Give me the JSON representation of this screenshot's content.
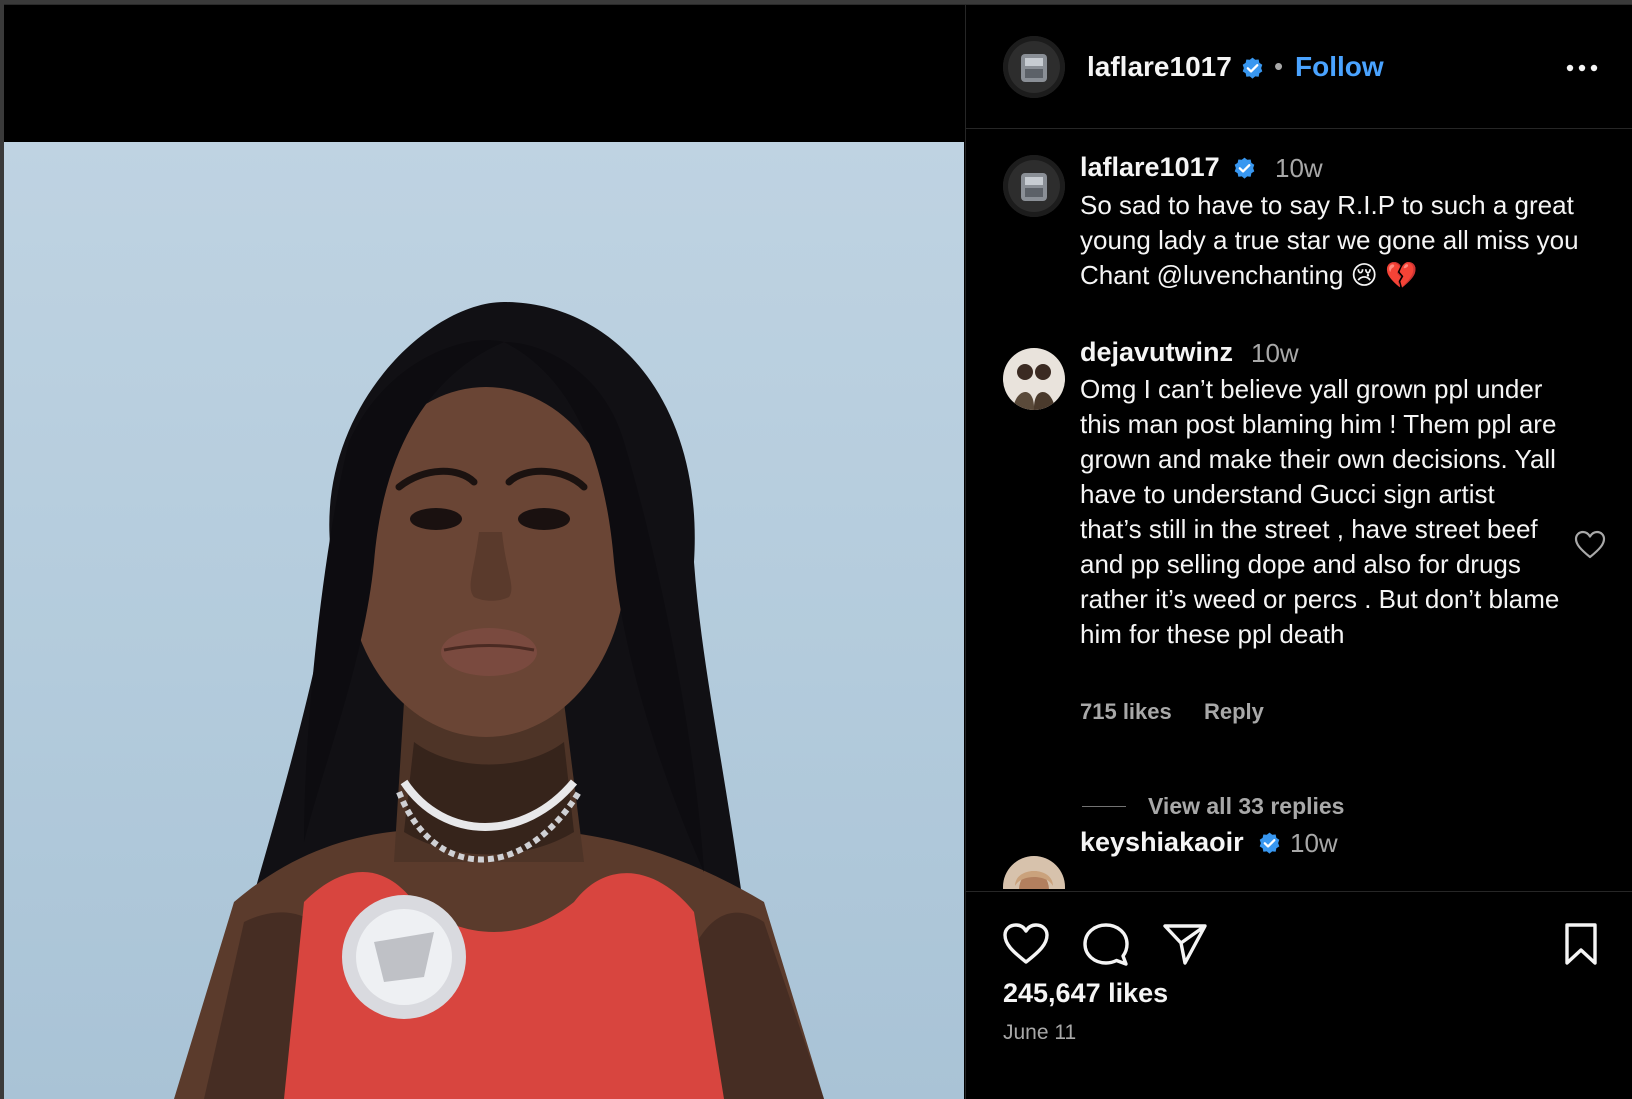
{
  "post": {
    "author": "laflare1017",
    "follow_label": "Follow",
    "separator": "•",
    "caption": {
      "author": "laflare1017",
      "time": "10w",
      "text": "So sad to have to say R.I.P to such a great young lady a true star we gone all miss you Chant @luvenchanting 😢 💔"
    },
    "likes": "245,647 likes",
    "date": "June 11"
  },
  "comments": [
    {
      "author": "dejavutwinz",
      "time": "10w",
      "text": "Omg I can’t believe yall grown ppl under this man post blaming him ! Them ppl are grown and make their own decisions. Yall have to understand Gucci sign artist that’s still in the street , have street beef and pp selling dope and also for drugs rather it’s weed or percs . But don’t blame him for these ppl death",
      "likes": "715 likes",
      "reply_label": "Reply",
      "view_replies": "View all 33 replies"
    },
    {
      "author": "keyshiakaoir",
      "time": "10w",
      "verified": true
    }
  ],
  "icons": {
    "more": "more-options-icon",
    "verified": "verified-badge-icon",
    "like": "heart-icon",
    "comment": "comment-bubble-icon",
    "share": "paper-plane-icon",
    "save": "bookmark-icon"
  },
  "colors": {
    "background": "#000000",
    "text": "#f5f5f5",
    "secondary_text": "#a8a8a8",
    "link": "#4aa3ff",
    "verified": "#3897f0",
    "photo_backdrop": "#b6cde0",
    "top_red": "#d8453f"
  }
}
